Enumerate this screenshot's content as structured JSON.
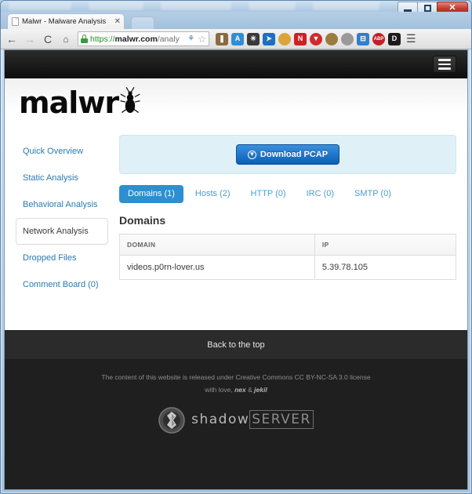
{
  "window": {
    "minimize_label": "Minimize",
    "maximize_label": "Maximize",
    "close_label": "✕"
  },
  "browser": {
    "tab": {
      "title": "Malwr - Malware Analysis",
      "close_label": "✕",
      "favicon": "page-icon"
    },
    "new_tab_label": "",
    "nav": {
      "back": "←",
      "forward": "→",
      "reload": "C",
      "home": "⌂"
    },
    "omnibox": {
      "scheme": "https://",
      "host": "malwr.com",
      "path": "/analy",
      "lock": "secure-lock-icon",
      "page_action": "⚘",
      "bookmark_star": "☆"
    },
    "extensions": [
      {
        "name": "lastpass-extension",
        "glyph": "❚❚",
        "color": "#8a6a40"
      },
      {
        "name": "translate-extension",
        "glyph": "A",
        "color": "#2f8fd6"
      },
      {
        "name": "wot-extension",
        "glyph": "✳",
        "color": "#3a3a3a"
      },
      {
        "name": "pocket-extension",
        "glyph": "➤",
        "color": "#1d6fc0"
      },
      {
        "name": "cookies-extension",
        "glyph": "●",
        "color": "#d9a43b"
      },
      {
        "name": "noscript-extension",
        "glyph": "N",
        "color": "#cf2026"
      },
      {
        "name": "downthemall-extension",
        "glyph": "▼",
        "color": "#d02b2b"
      },
      {
        "name": "session-extension",
        "glyph": "◗",
        "color": "#9b7b3e"
      },
      {
        "name": "globe-extension",
        "glyph": "⊕",
        "color": "#9a9a9a"
      },
      {
        "name": "bookmark-extension",
        "glyph": "⊟",
        "color": "#2f7fd0"
      },
      {
        "name": "adblockplus-extension",
        "glyph": "ABP",
        "color": "#c0202a"
      },
      {
        "name": "disconnect-extension",
        "glyph": "D",
        "color": "#1b1b1b"
      }
    ],
    "menu_glyph": "☰"
  },
  "site": {
    "menu_toggle_label": "menu",
    "logo_text": "malwr",
    "logo_bug": "bug-icon"
  },
  "sidebar": {
    "items": [
      {
        "label": "Quick Overview",
        "active": false
      },
      {
        "label": "Static Analysis",
        "active": false
      },
      {
        "label": "Behavioral Analysis",
        "active": false
      },
      {
        "label": "Network Analysis",
        "active": true
      },
      {
        "label": "Dropped Files",
        "active": false
      },
      {
        "label": "Comment Board (0)",
        "active": false
      }
    ]
  },
  "main": {
    "pcap": {
      "button_label": "Download PCAP",
      "icon": "download-circle-icon"
    },
    "tabs": [
      {
        "label": "Domains (1)",
        "active": true
      },
      {
        "label": "Hosts (2)",
        "active": false
      },
      {
        "label": "HTTP (0)",
        "active": false
      },
      {
        "label": "IRC (0)",
        "active": false
      },
      {
        "label": "SMTP (0)",
        "active": false
      }
    ],
    "section_title": "Domains",
    "table": {
      "columns": [
        "DOMAIN",
        "IP"
      ],
      "rows": [
        {
          "domain": "videos.p0rn-lover.us",
          "ip": "5.39.78.105"
        }
      ]
    }
  },
  "footer": {
    "back_to_top": "Back to the top",
    "license_line": "The content of this website is released under Creative Commons CC BY-NC-SA 3.0 license",
    "credits_prefix": "with love, ",
    "credits_author_1": "nex",
    "credits_sep": " & ",
    "credits_author_2": "jekil",
    "sponsor": {
      "word_1": "shadow",
      "word_2": "SERVER",
      "mark": "shadowserver-mark-icon"
    }
  },
  "colors": {
    "accent_blue": "#2d8fce",
    "button_blue": "#0a5fb8",
    "panel_blue": "#dff0f7",
    "link_blue": "#2a7ab0",
    "footer_dark": "#1f1f1f",
    "nav_black": "#0d0d0d"
  }
}
